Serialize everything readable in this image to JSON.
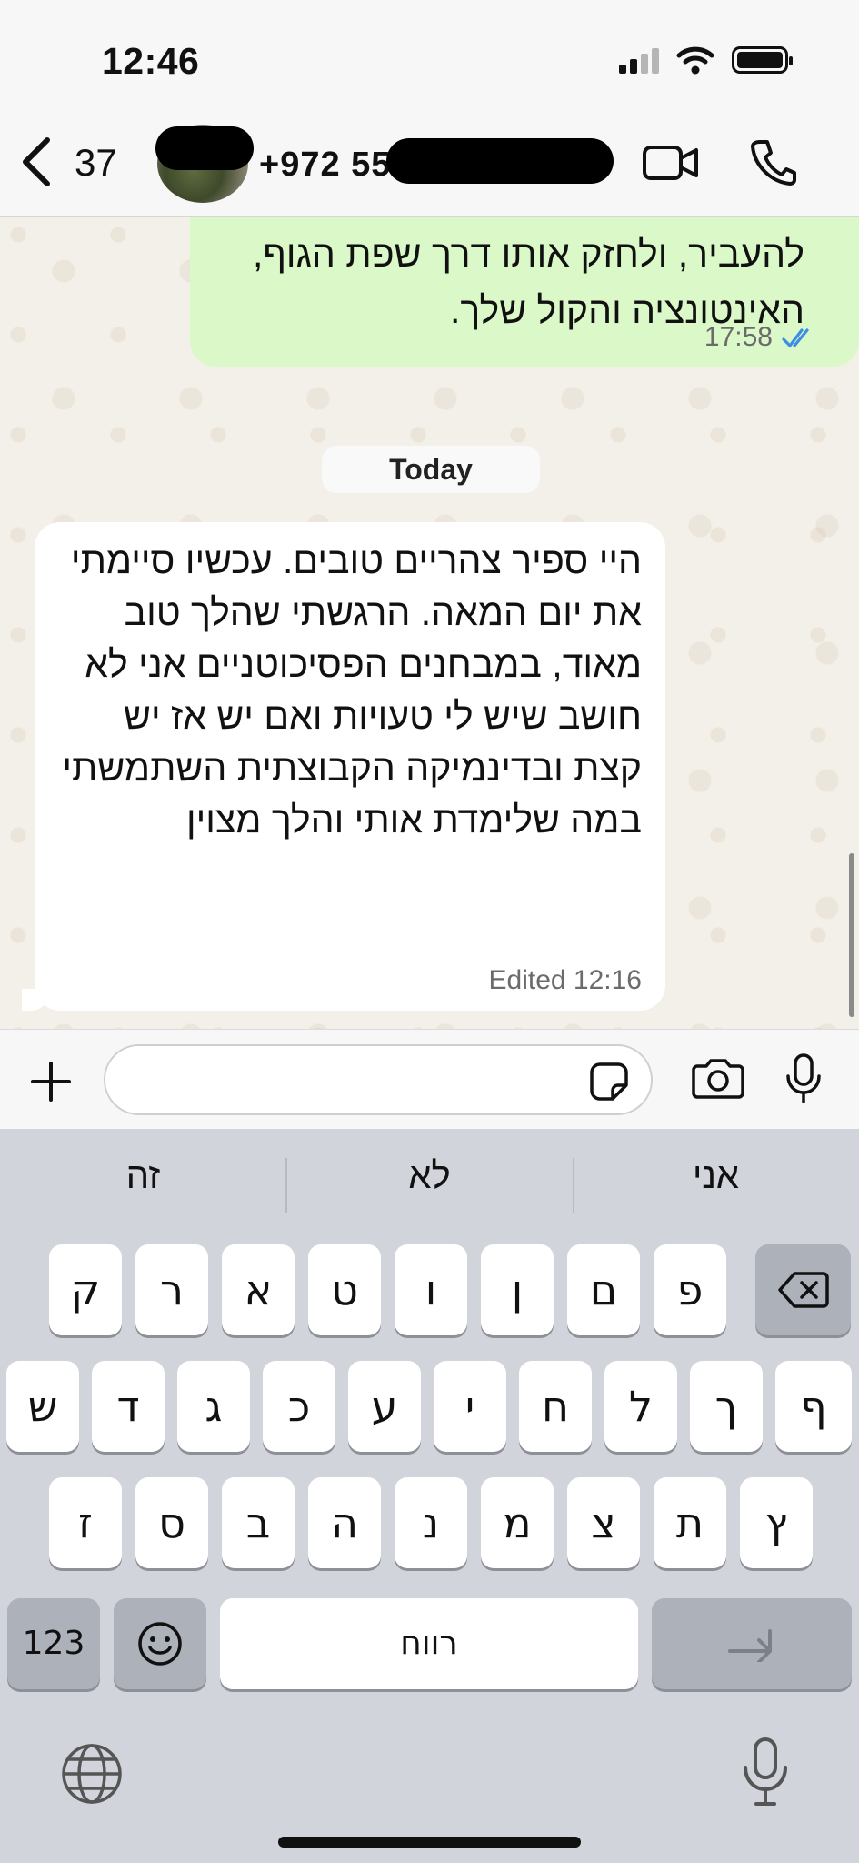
{
  "status_bar": {
    "time": "12:46"
  },
  "header": {
    "back_count": "37",
    "contact_visible": "+972 55"
  },
  "messages": {
    "outgoing": {
      "text": "להעביר, ולחזק אותו דרך שפת הגוף, האינטונציה והקול שלך.",
      "time": "17:58"
    },
    "date_separator": "Today",
    "incoming": {
      "text": "היי ספיר צהריים טובים. עכשיו סיימתי את יום המאה. הרגשתי שהלך טוב מאוד, במבחנים הפסיכוטניים אני לא חושב שיש לי טעויות ואם יש אז יש קצת ובדינמיקה הקבוצתית השתמשתי במה שלימדת אותי והלך מצוין",
      "edited_label": "Edited",
      "time": "12:16"
    }
  },
  "composer": {
    "value": "",
    "placeholder": ""
  },
  "keyboard": {
    "suggestions": [
      "זה",
      "לא",
      "אני"
    ],
    "row1": [
      "ק",
      "ר",
      "א",
      "ט",
      "ו",
      "ן",
      "ם",
      "פ"
    ],
    "row2": [
      "ש",
      "ד",
      "ג",
      "כ",
      "ע",
      "י",
      "ח",
      "ל",
      "ך",
      "ף"
    ],
    "row3": [
      "ז",
      "ס",
      "ב",
      "ה",
      "נ",
      "מ",
      "צ",
      "ת",
      "ץ"
    ],
    "numbers_label": "123",
    "space_label": "רווח"
  },
  "colors": {
    "outgoing_bubble": "#dbf8c9",
    "incoming_bubble": "#ffffff",
    "read_ticks": "#3a8ee6",
    "keyboard_bg": "#d1d4da"
  }
}
